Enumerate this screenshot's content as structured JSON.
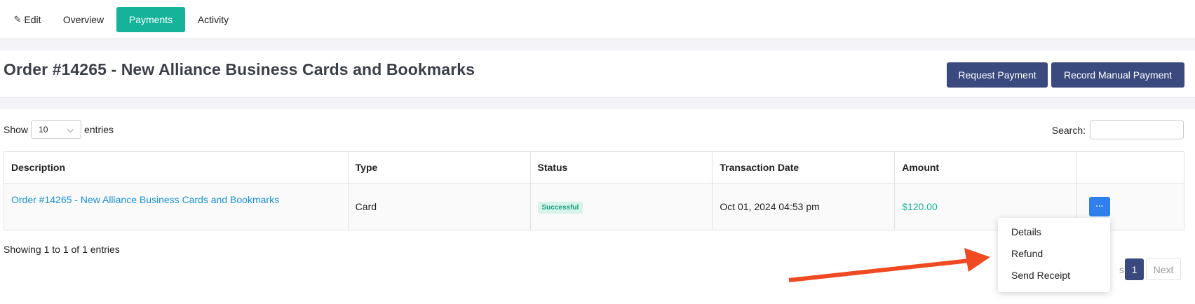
{
  "tabs": {
    "edit": "Edit",
    "overview": "Overview",
    "payments": "Payments",
    "activity": "Activity"
  },
  "header": {
    "title": "Order #14265 - New Alliance Business Cards and Bookmarks",
    "request_payment": "Request Payment",
    "record_manual_payment": "Record Manual Payment"
  },
  "controls": {
    "show_label": "Show",
    "page_size": "10",
    "entries_label": "entries",
    "search_label": "Search:",
    "search_value": ""
  },
  "table": {
    "columns": [
      "Description",
      "Type",
      "Status",
      "Transaction Date",
      "Amount",
      ""
    ],
    "rows": [
      {
        "description": "Order #14265 - New Alliance Business Cards and Bookmarks",
        "type": "Card",
        "status": "Successful",
        "date": "Oct 01, 2024 04:53 pm",
        "amount": "$120.00",
        "action": "···"
      }
    ]
  },
  "footer": {
    "showing": "Showing 1 to 1 of 1 entries",
    "prev": "s",
    "page": "1",
    "next": "Next"
  },
  "menu": {
    "items": [
      "Details",
      "Refund",
      "Send Receipt"
    ]
  },
  "colors": {
    "accent_teal": "#14b39a",
    "navy": "#3b4a7e",
    "blue_button": "#2f80ed",
    "link_blue": "#1a8fd6",
    "annotation_arrow": "#f04a23"
  }
}
